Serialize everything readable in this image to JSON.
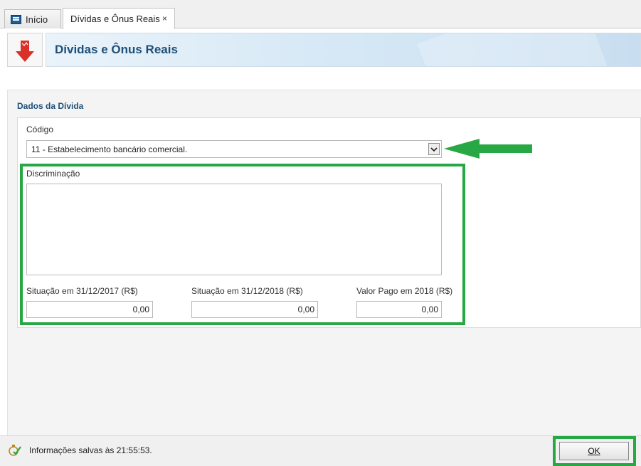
{
  "tabs": [
    {
      "label": "Início",
      "icon": "home-icon"
    },
    {
      "label": "Dívidas e Ônus Reais",
      "close_label": "×"
    }
  ],
  "header": {
    "title": "Dívidas e Ônus Reais",
    "icon": "download-arrow-icon"
  },
  "form": {
    "section_title": "Dados da Dívida",
    "codigo_label": "Código",
    "codigo_value": "11 - Estabelecimento bancário comercial.",
    "discriminacao_label": "Discriminação",
    "discriminacao_value": "",
    "situacao_2017_label": "Situação em 31/12/2017 (R$)",
    "situacao_2017_value": "0,00",
    "situacao_2018_label": "Situação em 31/12/2018 (R$)",
    "situacao_2018_value": "0,00",
    "valor_pago_label": "Valor Pago em 2018 (R$)",
    "valor_pago_value": "0,00"
  },
  "status": {
    "text": "Informações salvas às 21:55:53.",
    "icon": "saved-check-icon"
  },
  "buttons": {
    "ok_label": "OK"
  },
  "colors": {
    "highlight": "#27a844",
    "title_blue": "#1e4f78",
    "accent_red": "#d9322b"
  }
}
